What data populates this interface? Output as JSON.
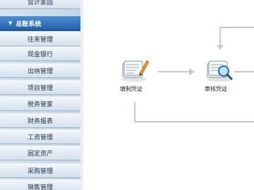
{
  "sidebar": {
    "items": [
      {
        "label": "会计家园"
      },
      {
        "label": "总账系统",
        "active": true
      },
      {
        "label": "往来管理"
      },
      {
        "label": "现金银行"
      },
      {
        "label": "出纳管理"
      },
      {
        "label": "项目管理"
      },
      {
        "label": "税务管家"
      },
      {
        "label": "财务报表"
      },
      {
        "label": "工资管理"
      },
      {
        "label": "固定资产"
      },
      {
        "label": "采购管理"
      },
      {
        "label": "销售管理"
      }
    ],
    "active_arrow": "▼"
  },
  "workflow": {
    "nodes": [
      {
        "label": "填制凭证",
        "icon": "voucher-entry-icon"
      },
      {
        "label": "审核凭证",
        "icon": "voucher-audit-icon"
      }
    ]
  }
}
